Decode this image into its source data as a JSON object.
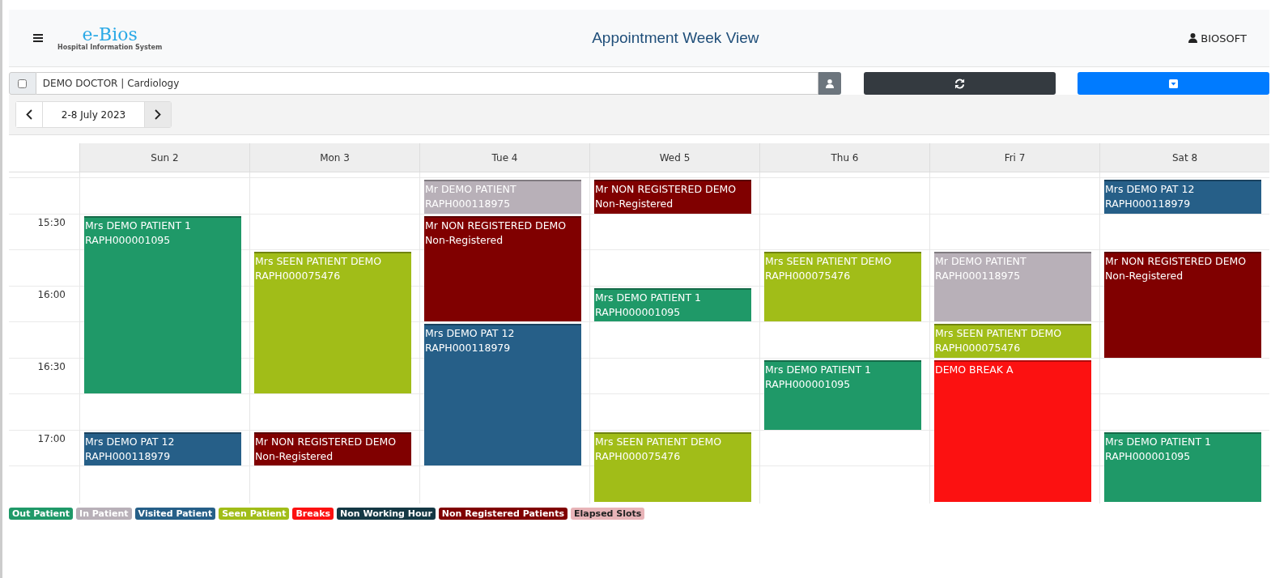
{
  "header": {
    "logo": "e-Bios",
    "logo_subtitle": "Hospital Information System",
    "title": "Appointment Week View",
    "user": "BIOSOFT"
  },
  "toolbar": {
    "select_all": {
      "checked": false
    },
    "doctor": "DEMO DOCTOR | Cardiology"
  },
  "navigation": {
    "range": "2-8 July 2023"
  },
  "calendar": {
    "time_slots": [
      {
        "kind": "blank"
      },
      {
        "kind": "label",
        "label": "15:30"
      },
      {
        "kind": "blank"
      },
      {
        "kind": "label",
        "label": "16:00"
      },
      {
        "kind": "blank"
      },
      {
        "kind": "label",
        "label": "16:30"
      },
      {
        "kind": "blank"
      },
      {
        "kind": "label",
        "label": "17:00"
      },
      {
        "kind": "blank"
      }
    ],
    "days": [
      {
        "label": "Sun 2",
        "slots": [
          {
            "kind": "empty"
          },
          {
            "kind": "out",
            "name": "Mrs DEMO PATIENT 1",
            "detail": "RAPH000001095"
          },
          {
            "kind": "continued"
          },
          {
            "kind": "continued"
          },
          {
            "kind": "continued"
          },
          {
            "kind": "continued"
          },
          {
            "kind": "empty"
          },
          {
            "kind": "visited",
            "name": "Mrs DEMO PAT 12",
            "detail": "RAPH000118979"
          },
          {
            "kind": "empty"
          }
        ]
      },
      {
        "label": "Mon 3",
        "slots": [
          {
            "kind": "empty"
          },
          {
            "kind": "empty"
          },
          {
            "kind": "seen",
            "name": "Mrs SEEN PATIENT DEMO",
            "detail": "RAPH000075476"
          },
          {
            "kind": "continued"
          },
          {
            "kind": "continued"
          },
          {
            "kind": "continued"
          },
          {
            "kind": "empty"
          },
          {
            "kind": "nonreg",
            "name": "Mr NON REGISTERED DEMO",
            "detail": "Non-Registered"
          },
          {
            "kind": "empty"
          }
        ]
      },
      {
        "label": "Tue 4",
        "slots": [
          {
            "kind": "in",
            "name": "Mr DEMO PATIENT",
            "detail": "RAPH000118975"
          },
          {
            "kind": "nonreg",
            "name": "Mr NON REGISTERED DEMO",
            "detail": "Non-Registered"
          },
          {
            "kind": "continued"
          },
          {
            "kind": "continued"
          },
          {
            "kind": "visited",
            "name": "Mrs DEMO PAT 12",
            "detail": "RAPH000118979"
          },
          {
            "kind": "continued"
          },
          {
            "kind": "continued"
          },
          {
            "kind": "continued"
          },
          {
            "kind": "empty"
          }
        ]
      },
      {
        "label": "Wed 5",
        "slots": [
          {
            "kind": "nonreg",
            "name": "Mr NON REGISTERED DEMO",
            "detail": "Non-Registered"
          },
          {
            "kind": "empty"
          },
          {
            "kind": "empty"
          },
          {
            "kind": "out",
            "name": "Mrs DEMO PATIENT 1",
            "detail": "RAPH000001095"
          },
          {
            "kind": "empty"
          },
          {
            "kind": "empty"
          },
          {
            "kind": "empty"
          },
          {
            "kind": "seen",
            "name": "Mrs SEEN PATIENT DEMO",
            "detail": "RAPH000075476"
          },
          {
            "kind": "continued"
          }
        ]
      },
      {
        "label": "Thu 6",
        "slots": [
          {
            "kind": "empty"
          },
          {
            "kind": "empty"
          },
          {
            "kind": "seen",
            "name": "Mrs SEEN PATIENT DEMO",
            "detail": "RAPH000075476"
          },
          {
            "kind": "continued"
          },
          {
            "kind": "empty"
          },
          {
            "kind": "out",
            "name": "Mrs DEMO PATIENT 1",
            "detail": "RAPH000001095"
          },
          {
            "kind": "continued"
          },
          {
            "kind": "empty"
          },
          {
            "kind": "empty"
          }
        ]
      },
      {
        "label": "Fri 7",
        "slots": [
          {
            "kind": "empty"
          },
          {
            "kind": "empty"
          },
          {
            "kind": "in",
            "name": "Mr DEMO PATIENT",
            "detail": "RAPH000118975"
          },
          {
            "kind": "continued"
          },
          {
            "kind": "seen",
            "name": "Mrs SEEN PATIENT DEMO",
            "detail": "RAPH000075476"
          },
          {
            "kind": "break",
            "name": "DEMO BREAK A"
          },
          {
            "kind": "continued"
          },
          {
            "kind": "continued"
          },
          {
            "kind": "continued"
          }
        ]
      },
      {
        "label": "Sat 8",
        "slots": [
          {
            "kind": "visited",
            "name": "Mrs DEMO PAT 12",
            "detail": "RAPH000118979"
          },
          {
            "kind": "empty"
          },
          {
            "kind": "nonreg",
            "name": "Mr NON REGISTERED DEMO",
            "detail": "Non-Registered"
          },
          {
            "kind": "continued"
          },
          {
            "kind": "continued"
          },
          {
            "kind": "empty"
          },
          {
            "kind": "empty"
          },
          {
            "kind": "out",
            "name": "Mrs DEMO PATIENT 1",
            "detail": "RAPH000001095"
          },
          {
            "kind": "continued"
          }
        ]
      }
    ]
  },
  "legend": [
    {
      "label": "Out Patient",
      "color": "#1f9968"
    },
    {
      "label": "In Patient",
      "color": "#b8b0b8"
    },
    {
      "label": "Visited Patient",
      "color": "#265f88"
    },
    {
      "label": "Seen Patient",
      "color": "#a1bd18"
    },
    {
      "label": "Breaks",
      "color": "#fc1111"
    },
    {
      "label": "Non Working Hour",
      "color": "#143844"
    },
    {
      "label": "Non Registered Patients",
      "color": "#800000"
    },
    {
      "label": "Elapsed Slots",
      "color": "#e8b4b8"
    }
  ]
}
